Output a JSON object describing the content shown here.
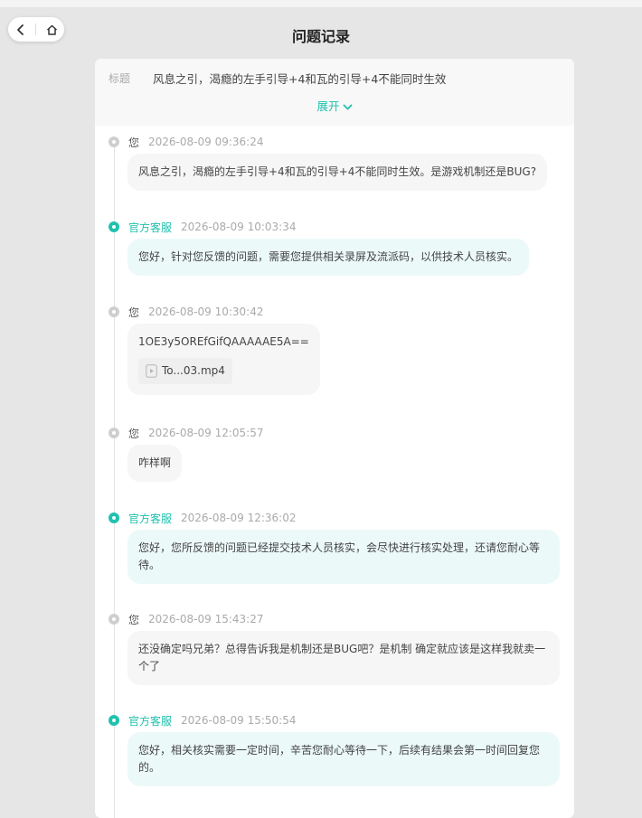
{
  "header": {
    "title": "问题记录"
  },
  "nav": {
    "back_icon": "chevron-left-icon",
    "home_icon": "home-icon"
  },
  "issue": {
    "title_label": "标题",
    "title_text": "风息之引，渴瘾的左手引导+4和瓦的引导+4不能同时生效",
    "expand_label": "展开"
  },
  "messages": [
    {
      "sender": "您",
      "role": "user",
      "time": "2026-08-09 09:36:24",
      "text": "风息之引，渴瘾的左手引导+4和瓦的引导+4不能同时生效。是游戏机制还是BUG?"
    },
    {
      "sender": "官方客服",
      "role": "staff",
      "time": "2026-08-09 10:03:34",
      "text": "您好，针对您反馈的问题，需要您提供相关录屏及流派码，以供技术人员核实。"
    },
    {
      "sender": "您",
      "role": "user",
      "time": "2026-08-09 10:30:42",
      "text": "1OE3y5OREfGifQAAAAAE5A==",
      "attachment": "To...03.mp4"
    },
    {
      "sender": "您",
      "role": "user",
      "time": "2026-08-09 12:05:57",
      "text": "咋样啊"
    },
    {
      "sender": "官方客服",
      "role": "staff",
      "time": "2026-08-09 12:36:02",
      "text": "您好，您所反馈的问题已经提交技术人员核实，会尽快进行核实处理，还请您耐心等待。"
    },
    {
      "sender": "您",
      "role": "user",
      "time": "2026-08-09 15:43:27",
      "text": "还没确定吗兄弟？总得告诉我是机制还是BUG吧？是机制 确定就应该是这样我就卖一个了"
    },
    {
      "sender": "官方客服",
      "role": "staff",
      "time": "2026-08-09 15:50:54",
      "text": "您好，相关核实需要一定时间，辛苦您耐心等待一下，后续有结果会第一时间回复您的。"
    }
  ],
  "colors": {
    "accent": "#1fc2ae",
    "staff_bubble": "#ecf9f9",
    "user_bubble": "#f6f6f6",
    "background": "#e6e6e6"
  }
}
